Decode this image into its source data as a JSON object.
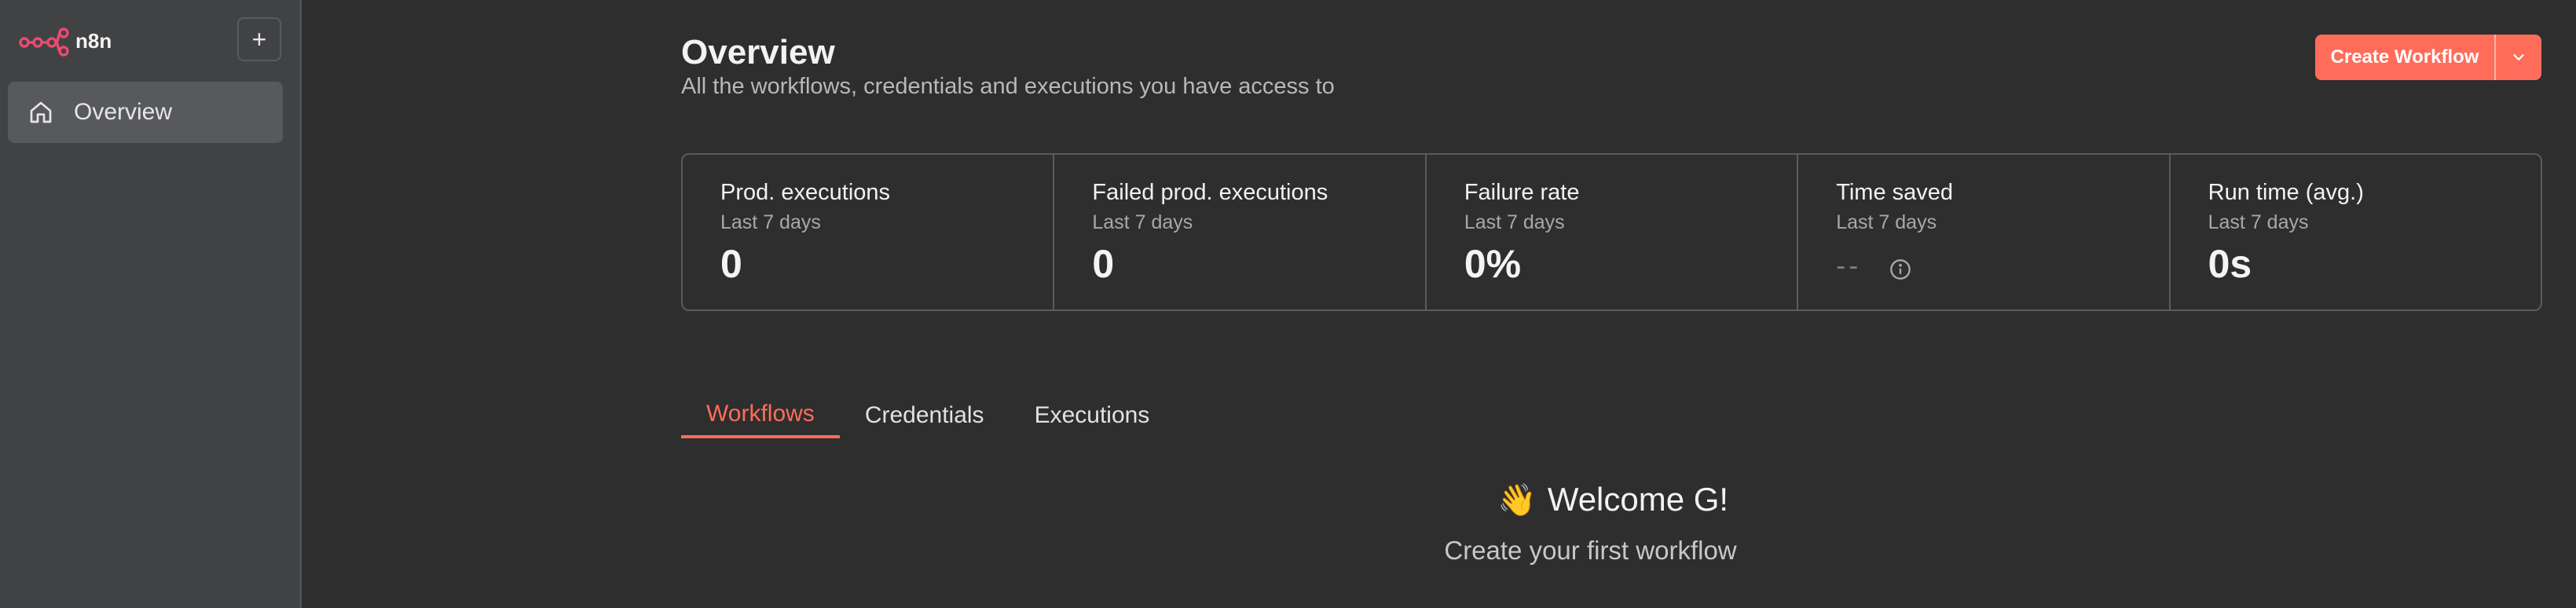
{
  "app": {
    "name": "n8n"
  },
  "colors": {
    "accent": "#ff6d5a",
    "sidebar": "#414244",
    "background": "#2e2e2e"
  },
  "sidebar": {
    "add_label": "+",
    "items": [
      {
        "label": "Overview",
        "icon": "home-icon",
        "active": true
      }
    ]
  },
  "header": {
    "title": "Overview",
    "subtitle": "All the workflows, credentials and executions you have access to",
    "create_label": "Create Workflow"
  },
  "stats": [
    {
      "label": "Prod. executions",
      "period": "Last 7 days",
      "value": "0"
    },
    {
      "label": "Failed prod. executions",
      "period": "Last 7 days",
      "value": "0"
    },
    {
      "label": "Failure rate",
      "period": "Last 7 days",
      "value": "0%"
    },
    {
      "label": "Time saved",
      "period": "Last 7 days",
      "value": "--"
    },
    {
      "label": "Run time (avg.)",
      "period": "Last 7 days",
      "value": "0s"
    }
  ],
  "tabs": [
    {
      "label": "Workflows",
      "active": true
    },
    {
      "label": "Credentials",
      "active": false
    },
    {
      "label": "Executions",
      "active": false
    }
  ],
  "welcome": {
    "emoji": "👋",
    "title": "Welcome G!",
    "subtitle": "Create your first workflow"
  }
}
